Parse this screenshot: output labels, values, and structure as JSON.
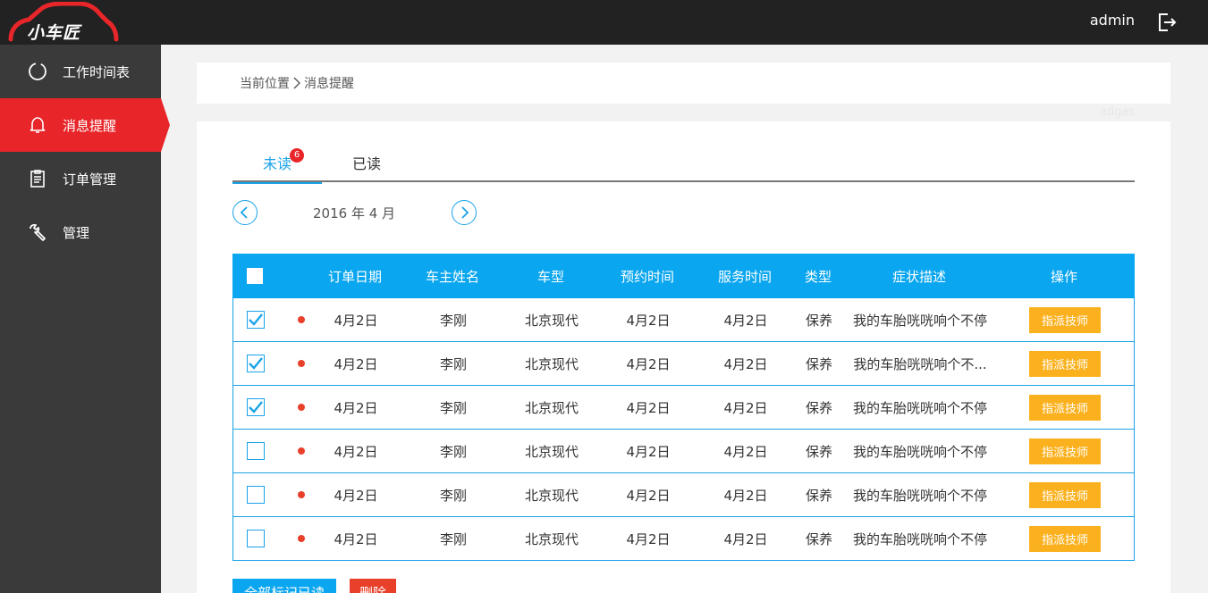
{
  "brand": {
    "name": "小车匠",
    "accent": "#e8262a"
  },
  "header": {
    "username": "admin",
    "logout_icon": "logout-icon"
  },
  "sidebar": {
    "items": [
      {
        "label": "工作时间表",
        "icon": "clock-circle-icon",
        "active": false
      },
      {
        "label": "消息提醒",
        "icon": "bell-icon",
        "active": true
      },
      {
        "label": "订单管理",
        "icon": "clipboard-icon",
        "active": false
      },
      {
        "label": "管理",
        "icon": "wrench-icon",
        "active": false
      }
    ]
  },
  "breadcrumb": {
    "root": "当前位置",
    "current": "消息提醒"
  },
  "ghost_text": "adgas",
  "tabs": {
    "unread": "未读",
    "unread_count": "6",
    "read": "已读"
  },
  "month": {
    "label": "2016 年 4 月"
  },
  "table": {
    "headers": [
      "订单日期",
      "车主姓名",
      "车型",
      "预约时间",
      "服务时间",
      "类型",
      "症状描述",
      "操作"
    ],
    "action_label": "指派技师",
    "rows": [
      {
        "checked": true,
        "date": "4月2日",
        "owner": "李刚",
        "model": "北京现代",
        "appt": "4月2日",
        "service": "4月2日",
        "type": "保养",
        "desc": "我的车胎咣咣响个不停"
      },
      {
        "checked": true,
        "date": "4月2日",
        "owner": "李刚",
        "model": "北京现代",
        "appt": "4月2日",
        "service": "4月2日",
        "type": "保养",
        "desc": "我的车胎咣咣响个不..."
      },
      {
        "checked": true,
        "date": "4月2日",
        "owner": "李刚",
        "model": "北京现代",
        "appt": "4月2日",
        "service": "4月2日",
        "type": "保养",
        "desc": "我的车胎咣咣响个不停"
      },
      {
        "checked": false,
        "date": "4月2日",
        "owner": "李刚",
        "model": "北京现代",
        "appt": "4月2日",
        "service": "4月2日",
        "type": "保养",
        "desc": "我的车胎咣咣响个不停"
      },
      {
        "checked": false,
        "date": "4月2日",
        "owner": "李刚",
        "model": "北京现代",
        "appt": "4月2日",
        "service": "4月2日",
        "type": "保养",
        "desc": "我的车胎咣咣响个不停"
      },
      {
        "checked": false,
        "date": "4月2日",
        "owner": "李刚",
        "model": "北京现代",
        "appt": "4月2日",
        "service": "4月2日",
        "type": "保养",
        "desc": "我的车胎咣咣响个不停"
      }
    ]
  },
  "footer": {
    "mark_all": "全部标记已读",
    "delete": "删除"
  }
}
